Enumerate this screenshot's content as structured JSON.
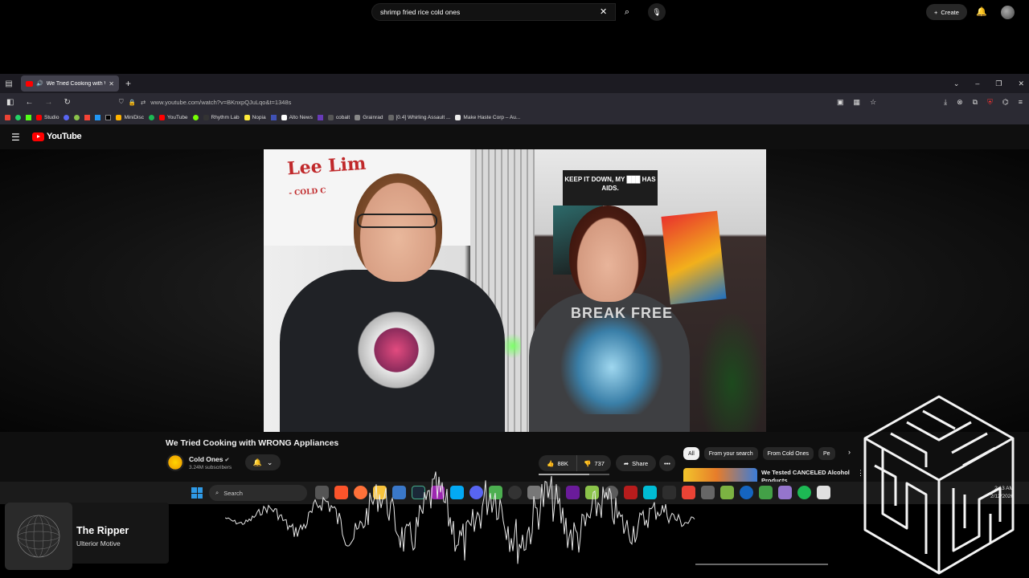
{
  "browser": {
    "tab_title": "We Tried Cooking with WRO",
    "url": "www.youtube.com/watch?v=BKnxpQJuLqo&t=1348s",
    "bookmarks": [
      "Studio",
      "MiniDisc",
      "YouTube",
      "Rhythm Lab",
      "Nopia",
      "Alto News",
      "cobalt",
      "Grainrad",
      "[0.4] Whirling Assault ...",
      "Make Haste Corp – Au..."
    ],
    "extension_badge": "129"
  },
  "youtube": {
    "logo_text": "YouTube",
    "search_query": "shrimp fried rice cold ones",
    "create_label": "Create"
  },
  "video": {
    "sign_text": "Lee Lim",
    "sign_sub": "- COLD C",
    "wall_sign": "KEEP IT DOWN, MY ███ HAS AIDS.",
    "shirt_text": "BREAK FREE",
    "title": "We Tried Cooking with WRONG Appliances",
    "channel": "Cold Ones",
    "subscribers": "3.24M subscribers",
    "likes": "88K",
    "dislikes": "737",
    "share_label": "Share",
    "like_ratio": 0.72
  },
  "recommendations": {
    "chips": [
      "All",
      "From your search",
      "From Cold Ones",
      "Pe"
    ],
    "first_title": "We Tested CANCELED Alcohol Products"
  },
  "taskbar": {
    "search_label": "Search",
    "time": "2:13 AM",
    "date": "2/12/2026"
  },
  "now_playing": {
    "title": "The Ripper",
    "artist": "Ulterior Motive"
  }
}
